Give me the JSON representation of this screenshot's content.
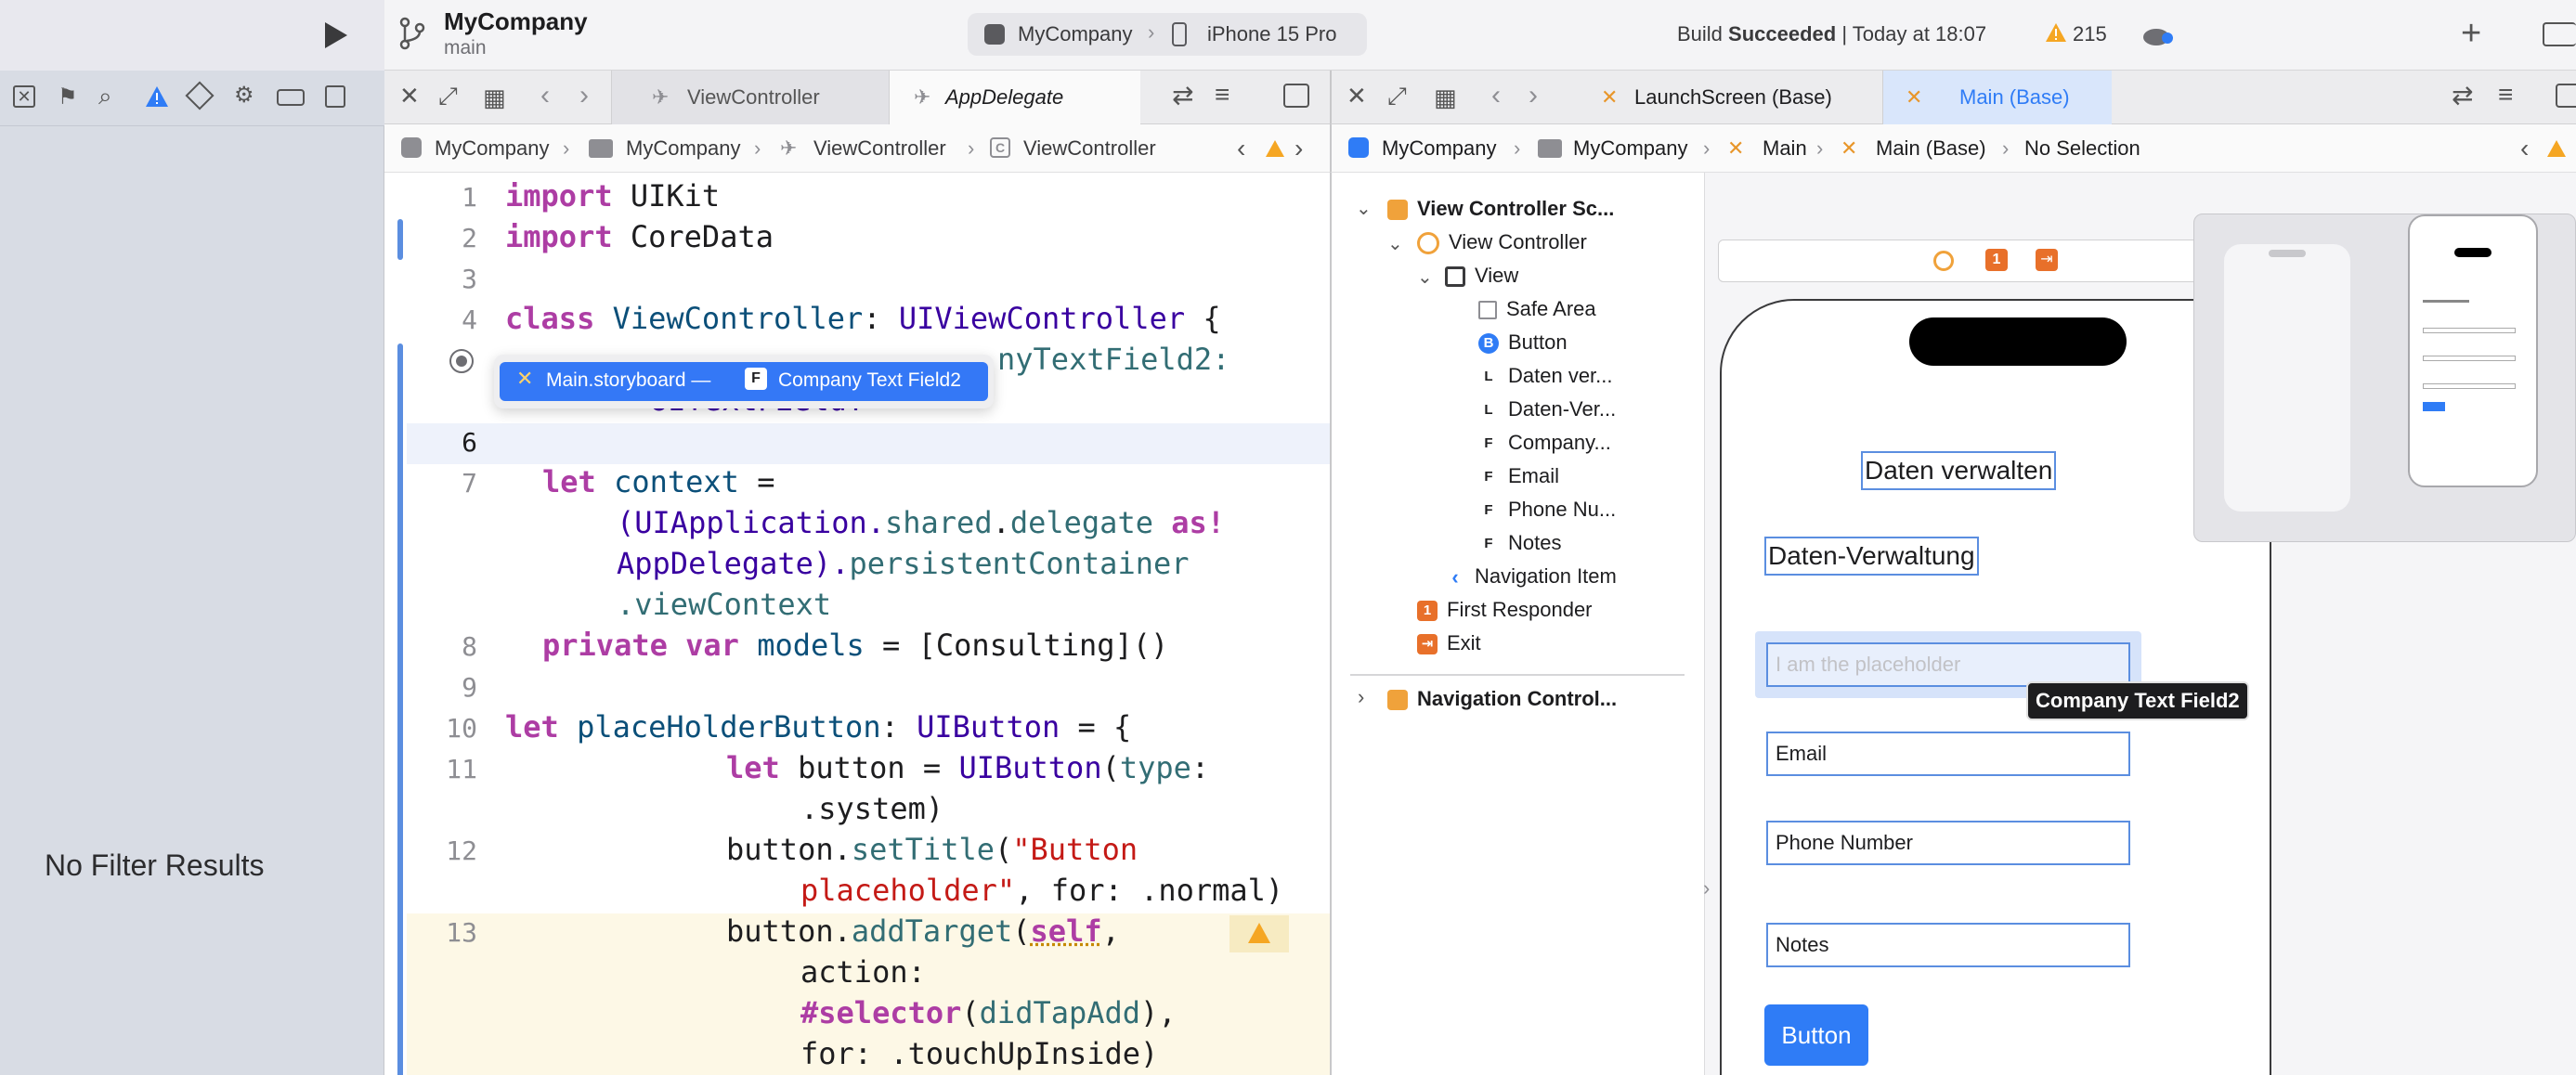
{
  "toolbar": {
    "project_name": "MyCompany",
    "branch": "main",
    "scheme": "MyCompany",
    "device": "iPhone 15 Pro",
    "status_prefix": "Build ",
    "status_bold": "Succeeded",
    "status_time": " | Today at 18:07",
    "warning_count": "215"
  },
  "navigator": {
    "empty_text": "No Filter Results"
  },
  "editor": {
    "tabs": [
      "ViewController",
      "AppDelegate"
    ],
    "jumpbar": [
      "MyCompany",
      "MyCompany",
      "ViewController",
      "ViewController"
    ],
    "popup": {
      "file": "Main.storyboard —",
      "badge": "F",
      "field": "Company Text Field2"
    },
    "line_numbers": [
      "1",
      "2",
      "3",
      "4",
      "",
      "6",
      "7",
      "",
      "",
      "",
      "8",
      "9",
      "10",
      "11",
      "",
      "12",
      "",
      "13",
      "",
      "",
      ""
    ],
    "lines": {
      "l1_kw": "import",
      "l1_rest": " UIKit",
      "l2_kw": "import",
      "l2_rest": " CoreData",
      "l4_kw": "class",
      "l4_name": " ViewController",
      "l4_sep": ": ",
      "l4_type": "UIViewController",
      "l4_end": " {",
      "l5_tail": "nyTextField2:",
      "l5b": "UITextField!",
      "l7_kw": "let",
      "l7_name": " context",
      "l7_rest": " =",
      "l7b_a": "(UIApplication.",
      "l7b_b": "shared",
      "l7b_c": ".",
      "l7b_d": "delegate",
      "l7b_e": " as!",
      "l7c_a": "AppDelegate).",
      "l7c_b": "persistentContainer",
      "l7d": ".viewContext",
      "l8_kw": "private var",
      "l8_name": " models",
      "l8_rest": " = [Consulting]()",
      "l10_kw": "let",
      "l10_name": " placeHolderButton",
      "l10_sep": ": ",
      "l10_type": "UIButton",
      "l10_end": " = {",
      "l11_kw": "let",
      "l11_rest": " button = ",
      "l11_type": "UIButton",
      "l11_a": "(",
      "l11_b": "type",
      "l11_c": ":",
      "l11b": ".system)",
      "l12_a": "button.",
      "l12_b": "setTitle",
      "l12_c": "(",
      "l12_str": "\"Button",
      "l12b_str": "placeholder\"",
      "l12b_rest": ", for: .normal)",
      "l13_a": "button.",
      "l13_b": "addTarget",
      "l13_c": "(",
      "l13_self": "self",
      "l13_d": ",",
      "l13b": "action:",
      "l13c_kw": "#selector",
      "l13c_a": "(",
      "l13c_b": "didTapAdd",
      "l13c_c": "),",
      "l13d": "for: .touchUpInside)"
    }
  },
  "canvas": {
    "tabs": [
      "LaunchScreen (Base)",
      "Main (Base)"
    ],
    "jumpbar": [
      "MyCompany",
      "MyCompany",
      "Main",
      "Main (Base)",
      "No Selection"
    ],
    "outline": [
      {
        "label": "View Controller Sc...",
        "badge": ""
      },
      {
        "label": "View Controller",
        "badge": ""
      },
      {
        "label": "View",
        "badge": ""
      },
      {
        "label": "Safe Area",
        "badge": ""
      },
      {
        "label": "Button",
        "badge": "B"
      },
      {
        "label": "Daten ver...",
        "badge": "L"
      },
      {
        "label": "Daten-Ver...",
        "badge": "L"
      },
      {
        "label": "Company...",
        "badge": "F"
      },
      {
        "label": "Email",
        "badge": "F"
      },
      {
        "label": "Phone Nu...",
        "badge": "F"
      },
      {
        "label": "Notes",
        "badge": "F"
      },
      {
        "label": "Navigation Item",
        "badge": ""
      },
      {
        "label": "First Responder",
        "badge": "1"
      },
      {
        "label": "Exit",
        "badge": ""
      },
      {
        "label": "Navigation Control...",
        "badge": ""
      }
    ],
    "scene": {
      "title_label": "Daten verwalten",
      "subtitle_label": "Daten-Verwaltung",
      "placeholder": "I am the placeholder",
      "tooltip": "Company Text Field2",
      "email": "Email",
      "phone": "Phone Number",
      "notes": "Notes",
      "button": "Button",
      "scene_badge": "1"
    }
  },
  "colors": {
    "accent": "#2f7cf6",
    "warning": "#f5a623",
    "keyword": "#ad3da4"
  }
}
